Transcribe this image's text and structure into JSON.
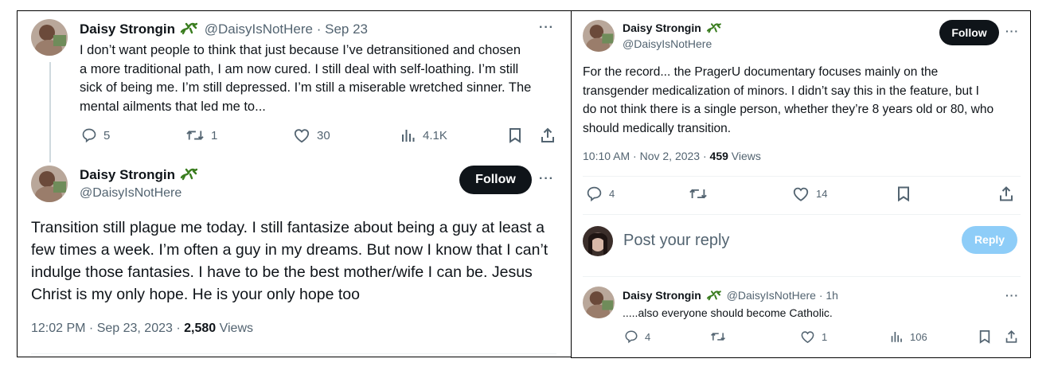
{
  "left_panel": {
    "tweet1": {
      "display_name": "Daisy Strongin",
      "handle": "@DaisyIsNotHere",
      "date": "· Sep 23",
      "text_lines": [
        "I don’t want people to think that just because I’ve detransitioned and chosen",
        "a more traditional path, I am now cured. I still deal with self-loathing. I’m still",
        "sick of being me. I’m still depressed. I’m still a miserable wretched sinner. The",
        "mental ailments that led me to..."
      ],
      "more_label": "···",
      "replies": "5",
      "retweets": "1",
      "likes": "30",
      "views": "4.1K"
    },
    "tweet2": {
      "display_name": "Daisy Strongin",
      "handle": "@DaisyIsNotHere",
      "follow_label": "Follow",
      "more_label": "···",
      "text_lines": [
        "Transition still plague me today. I still fantasize about being a guy at least a",
        "few times a week. I’m often a guy in my dreams. But now I know that I can’t",
        "indulge those fantasies. I have to be the best mother/wife I can be. Jesus",
        "Christ is my only hope. He is your only hope too"
      ],
      "timestamp": "12:02 PM · Sep 23, 2023 · ",
      "view_count": "2,580",
      "views_label": " Views"
    }
  },
  "right_panel": {
    "main_tweet": {
      "display_name": "Daisy Strongin",
      "handle": "@DaisyIsNotHere",
      "follow_label": "Follow",
      "more_label": "···",
      "text_lines": [
        "For the record... the PragerU documentary focuses mainly on the",
        "transgender medicalization of minors. I didn’t say this in the feature, but I",
        "do not think there is a single person, whether they’re 8 years old or 80, who",
        "should medically transition."
      ],
      "timestamp": "10:10 AM · Nov 2, 2023 · ",
      "view_count": "459",
      "views_label": " Views",
      "replies": "4",
      "likes": "14"
    },
    "reply_box": {
      "placeholder": "Post your reply",
      "reply_label": "Reply"
    },
    "reply_tweet": {
      "display_name": "Daisy Strongin",
      "handle": "@DaisyIsNotHere",
      "time": "· 1h",
      "more_label": "···",
      "text": ".....also everyone should become Catholic.",
      "replies": "4",
      "likes": "1",
      "views": "106"
    }
  },
  "colors": {
    "text": "#0f1419",
    "muted": "#536471",
    "follow_bg": "#0f1419",
    "reply_button_bg": "#8ecdf8",
    "thread_line": "#cfd9de",
    "gecko_green": "#3a7d1f"
  },
  "icons": [
    "reply-icon",
    "retweet-icon",
    "like-icon",
    "views-icon",
    "bookmark-icon",
    "share-icon",
    "gecko-emoji-icon",
    "more-icon"
  ]
}
